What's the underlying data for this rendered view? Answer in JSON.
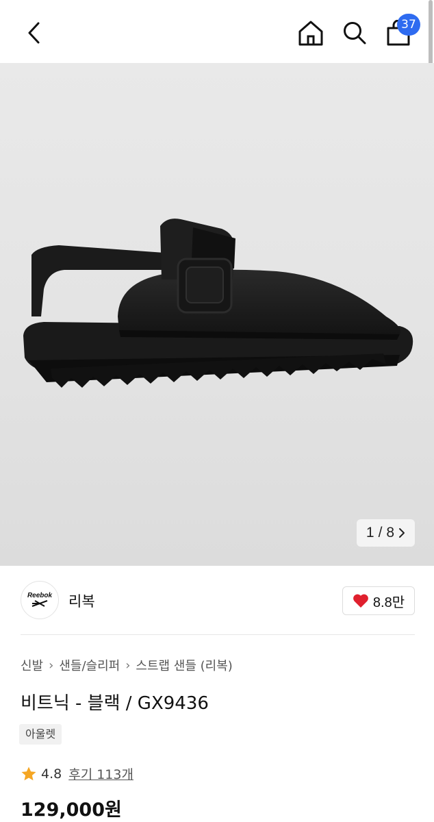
{
  "topbar": {
    "cart_count": "37",
    "icons": [
      "chevron-left-icon",
      "home-icon",
      "search-icon",
      "shopping-bag-icon"
    ]
  },
  "gallery": {
    "current": "1",
    "separator": "/",
    "total": "8",
    "background": "#e6e6e6"
  },
  "brand": {
    "logo_text": "Reebok",
    "name": "리복",
    "likes": "8.8만",
    "like_color": "#e0202e"
  },
  "breadcrumb": [
    "신발",
    "샌들/슬리퍼",
    "스트랩 샌들 (리복)"
  ],
  "product": {
    "title": "비트닉 - 블랙 / GX9436",
    "tag": "아울렛",
    "rating": "4.8",
    "reviews": "후기 113개",
    "price": "129,000원",
    "rating_color": "#f5a623"
  },
  "colors": {
    "accent": "#2e6bf0"
  }
}
